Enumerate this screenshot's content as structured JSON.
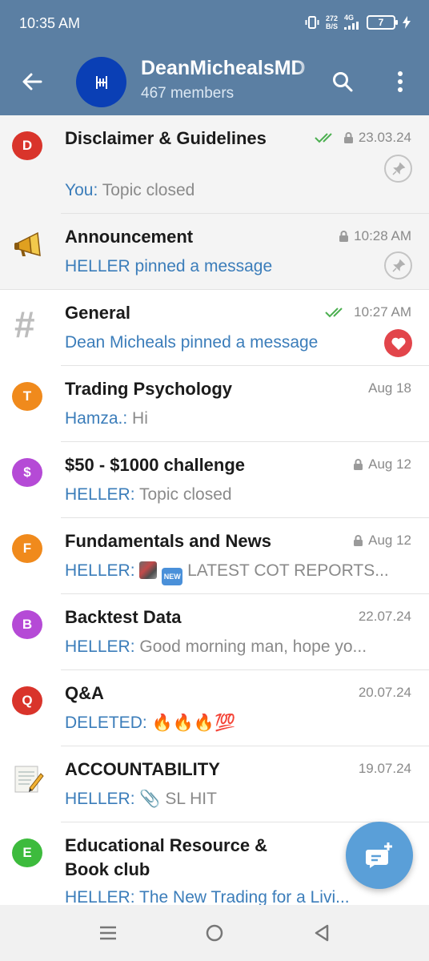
{
  "status": {
    "time": "10:35 AM",
    "net_speed_value": "272",
    "net_speed_unit": "B/S",
    "signal": "4G",
    "battery": "7"
  },
  "header": {
    "title": "DeanMichealsMD",
    "subtitle": "467 members"
  },
  "topics": [
    {
      "title": "Disclaimer & Guidelines",
      "sender": "You:",
      "preview": " Topic closed",
      "date": "23.03.24",
      "icon": "D",
      "color": "#d9342b"
    },
    {
      "title": "Announcement",
      "sender": "HELLER pinned a message",
      "preview": "",
      "date": "10:28 AM",
      "icon": "megaphone-icon"
    },
    {
      "title": "General",
      "sender": "Dean Micheals pinned a message",
      "preview": "",
      "date": "10:27 AM",
      "icon": "hashtag-icon"
    },
    {
      "title": "Trading Psychology",
      "sender": "Hamza.:",
      "preview": " Hi",
      "date": "Aug 18",
      "icon": "T",
      "color": "#f08a1c"
    },
    {
      "title": "$50 - $1000 challenge",
      "sender": "HELLER:",
      "preview": " Topic closed",
      "date": "Aug 12",
      "icon": "$",
      "color": "#b54ad6"
    },
    {
      "title": "Fundamentals and News",
      "sender": "HELLER:",
      "preview": " LATEST COT REPORTS...",
      "date": "Aug 12",
      "icon": "F",
      "color": "#f08a1c",
      "badge": "NEW"
    },
    {
      "title": "Backtest Data",
      "sender": "HELLER:",
      "preview": " Good morning man, hope  yo...",
      "date": "22.07.24",
      "icon": "B",
      "color": "#b54ad6"
    },
    {
      "title": "Q&A",
      "sender": "DELETED:",
      "preview": " 🔥🔥🔥💯",
      "date": "20.07.24",
      "icon": "Q",
      "color": "#d9342b"
    },
    {
      "title": "ACCOUNTABILITY",
      "sender": "HELLER:",
      "preview": " 📎 SL HIT",
      "date": "19.07.24",
      "icon": "memo-icon"
    },
    {
      "title": "Educational Resource & Book club",
      "sender": "HELLER:",
      "preview": " The  New  Trading  for  a  Livi...",
      "date": "",
      "icon": "E",
      "color": "#3dbb3d"
    }
  ],
  "colors": {
    "header_bg": "#5b7fa3",
    "accent_blue": "#3b7dba",
    "read_check": "#4caf50",
    "heart": "#e2454b",
    "fab": "#5a9fd8"
  }
}
